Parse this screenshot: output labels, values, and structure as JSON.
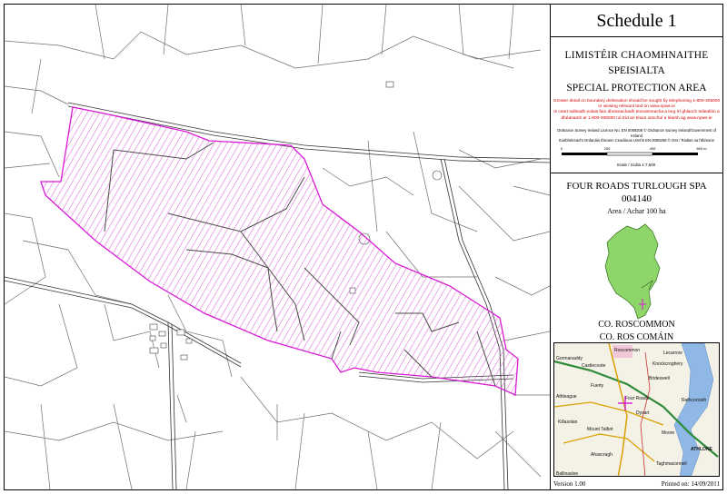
{
  "schedule": "Schedule 1",
  "limit_irish": "LIMISTÉIR CHAOMHNAITHE",
  "limit_irish2": "SPEISIALTA",
  "limit_english": "SPECIAL PROTECTION AREA",
  "notice_english": "Greater detail on boundary delineation should be sought by telephoning 1-800-405000 or viewing relevant text on www.npws.ie",
  "notice_irish": "Is ceart tuilleadh eolais faoi dhoiseachadh teorainneacha a lorg trí ghlaoch teileafóin a dhéanamh ar 1-800-405000 nó tríd an téacs iomchuí a léamh ag www.npws.ie",
  "licence_english": "Ordnance Survey Ireland Licence No. EN 0059208 © Ordnance Survey Ireland/Government of Ireland",
  "licence_irish": "Suirbhéireacht Ordanáis Éireann Ceadúnas Uimhir EN 0059208 © OSI / Rialtas na hÉireann",
  "scale_ticks": [
    "0",
    "200",
    "400",
    "600 m"
  ],
  "scale_label": "Scale / Scála 1:7,500",
  "site_name": "FOUR ROADS TURLOUGH SPA",
  "site_code": "004140",
  "site_area": "Area / Achar 100 ha",
  "county_english": "CO. ROSCOMMON",
  "county_irish": "CO. ROS COMÁIN",
  "version": "Version 1.00",
  "printed": "Printed on: 14/09/2011",
  "location_labels": [
    "Roscommon",
    "Gormanaddy",
    "Castlecoote",
    "Athleague",
    "Fuerty",
    "Four Roads",
    "Dysart",
    "Ballinasloe",
    "Brideswell",
    "Knockcroghery",
    "Lecarrow",
    "ATHLONE",
    "Taghmaconnell",
    "Rathconrath",
    "Killasolan",
    "Mount Talbot",
    "Moore",
    "Ahascragh"
  ],
  "colors": {
    "spa_boundary": "#d81bd6",
    "spa_hatch": "#e065d8",
    "lake": "#8fb8e6",
    "road_national": "#2e8b3a",
    "road_regional": "#d9a000"
  }
}
